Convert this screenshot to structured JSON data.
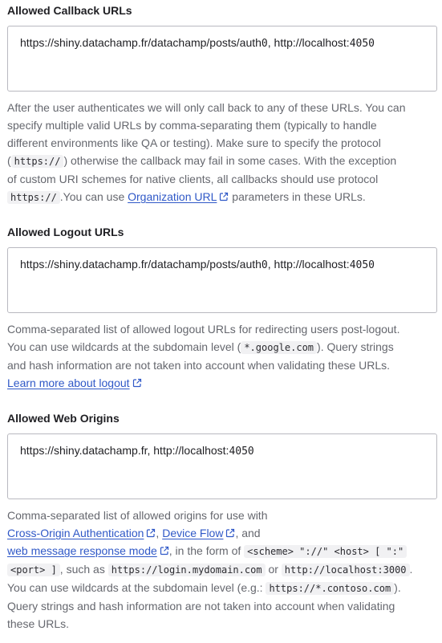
{
  "callback": {
    "label": "Allowed Callback URLs",
    "value_prefix": "https://shiny.datachamp.fr/datachamp/posts/auth",
    "value_digit": "0",
    "value_mid": ", http://localhost:",
    "value_port": "4050",
    "help": {
      "l1": "After the user authenticates we will only call back to any of these URLs. You can",
      "l2": "specify multiple valid URLs by comma-separating them (typically to handle",
      "l3": "different environments like QA or testing). Make sure to specify the protocol",
      "l4_pre": "(",
      "l4_code": "https://",
      "l4_post": ") otherwise the callback may fail in some cases. With the exception",
      "l5": "of custom URI schemes for native clients, all callbacks should use protocol",
      "l6_code": "https://",
      "l6_mid": ".You can use ",
      "l6_link": "Organization URL",
      "l6_post": " parameters in these URLs."
    }
  },
  "logout": {
    "label": "Allowed Logout URLs",
    "value_prefix": "https://shiny.datachamp.fr/datachamp/posts/auth",
    "value_digit": "0",
    "value_mid": ", http://localhost:",
    "value_port": "4050",
    "help": {
      "l1": "Comma-separated list of allowed logout URLs for redirecting users post-logout.",
      "l2_pre": "You can use wildcards at the subdomain level (",
      "l2_code": "*.google.com",
      "l2_post": "). Query strings",
      "l3": "and hash information are not taken into account when validating these URLs.",
      "l4_link": "Learn more about logout"
    }
  },
  "origins": {
    "label": "Allowed Web Origins",
    "value_prefix": "https://shiny.datachamp.fr, http://localhost:",
    "value_port": "4050",
    "help": {
      "l1": "Comma-separated list of allowed origins for use with",
      "l2_link1": "Cross-Origin Authentication",
      "l2_sep": ", ",
      "l2_link2": "Device Flow",
      "l2_post": ", and",
      "l3_link": "web message response mode",
      "l3_mid": ", in the form of ",
      "l3_code": "<scheme> \"://\" <host> [ \":\"",
      "l4_code1": "<port> ]",
      "l4_mid1": ", such as ",
      "l4_code2": "https://login.mydomain.com",
      "l4_mid2": " or ",
      "l4_code3": "http://localhost:3000",
      "l4_post": ".",
      "l5_pre": "You can use wildcards at the subdomain level (e.g.: ",
      "l5_code": "https://*.contoso.com",
      "l5_post": ").",
      "l6": "Query strings and hash information are not taken into account when validating",
      "l7": "these URLs."
    }
  },
  "icons": {
    "external_link": "external-link-icon"
  },
  "colors": {
    "link": "#2f58c7",
    "help_text": "#65676e",
    "border": "#b9b9c0",
    "code_bg": "#f1f1f3"
  }
}
